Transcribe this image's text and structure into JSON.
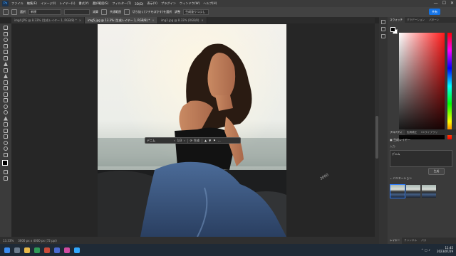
{
  "app": {
    "logo": "Ps"
  },
  "menu": [
    "ファイル",
    "編集(E)",
    "イメージ(I)",
    "レイヤー(L)",
    "書式(Y)",
    "選択範囲(S)",
    "フィルター(T)",
    "3D(D)",
    "表示(V)",
    "プラグイン",
    "ウィンドウ(W)",
    "ヘルプ(H)"
  ],
  "window_controls": {
    "minimize": "—",
    "maximize": "☐",
    "close": "✕"
  },
  "options": {
    "mode_label": "選択",
    "mode_value": "新規",
    "subtract": "減算",
    "intersect": "共通範囲",
    "refine": "切り抜く(フチをぼかす)を選択",
    "width_label": "調整",
    "gen_fill": "生成塗りつぶし",
    "share": "共有"
  },
  "tabs": [
    {
      "label": "img4.JPG @ 8.33% (生成レイヤー 1, RGB/8) *",
      "active": false
    },
    {
      "label": "img5.jpg @ 13.3% (生成レイヤー 1, RGB/8) *",
      "active": true
    },
    {
      "label": "img2.jpg @ 8.33% (RGB/8)",
      "active": false
    }
  ],
  "context_bar": {
    "prompt": "デニム",
    "page": "1/3",
    "generate": "生成",
    "more": "…"
  },
  "cursor_label": "2000",
  "status": {
    "zoom": "13.33%",
    "doc": "3000 px x 4000 px (72 ppi)"
  },
  "panel": {
    "top_tabs": [
      "スウォッチ",
      "グラデーション",
      "パターン"
    ],
    "prop_tabs": [
      "プロパティ",
      "色調補正",
      "CCライブラリ"
    ],
    "layer_type": "生成レイヤー",
    "input_label": "入力：",
    "prompt_value": "デニム",
    "generate": "生成",
    "variations": "バリエーション",
    "variation_count": 3,
    "bottom_tabs": [
      "レイヤー",
      "チャンネル",
      "パス"
    ]
  },
  "colors": {
    "accent": "#1473e6",
    "fg": "#000000",
    "bg": "#ffffff",
    "hue": "#ff1a1a"
  },
  "taskbar": {
    "time": "11:45",
    "date": "2023/07/29"
  }
}
